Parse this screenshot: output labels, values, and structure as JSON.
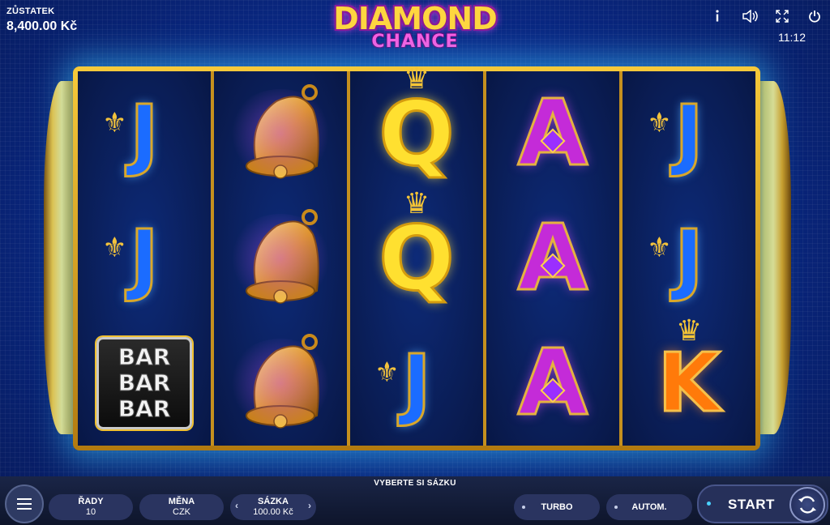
{
  "header": {
    "balance_label": "ZŮSTATEK",
    "balance_value": "8,400.00 Kč",
    "logo_line1": "DIAMOND",
    "logo_line2": "CHANCE",
    "clock": "11:12",
    "icons": [
      "info-icon",
      "sound-icon",
      "fullscreen-icon",
      "power-icon"
    ]
  },
  "reels": [
    [
      "J",
      "J",
      "BAR"
    ],
    [
      "BELL",
      "BELL",
      "BELL"
    ],
    [
      "Q",
      "Q",
      "J"
    ],
    [
      "A",
      "A",
      "A"
    ],
    [
      "J",
      "J",
      "K"
    ]
  ],
  "bar_symbol_lines": [
    "BAR",
    "BAR",
    "BAR"
  ],
  "footer": {
    "bet_hint": "VYBERTE SI SÁZKU",
    "lines_label": "ŘADY",
    "lines_value": "10",
    "currency_label": "MĚNA",
    "currency_value": "CZK",
    "bet_label": "SÁZKA",
    "bet_value": "100.00 Kč",
    "turbo_label": "TURBO",
    "auto_label": "AUTOM.",
    "start_label": "START"
  },
  "colors": {
    "background": "#0a2a8a",
    "frame_gold": "#f2c23c",
    "J": "#1b6cff",
    "Q": "#ffe030",
    "A": "#c42bd8",
    "K": "#ff7a0a"
  }
}
